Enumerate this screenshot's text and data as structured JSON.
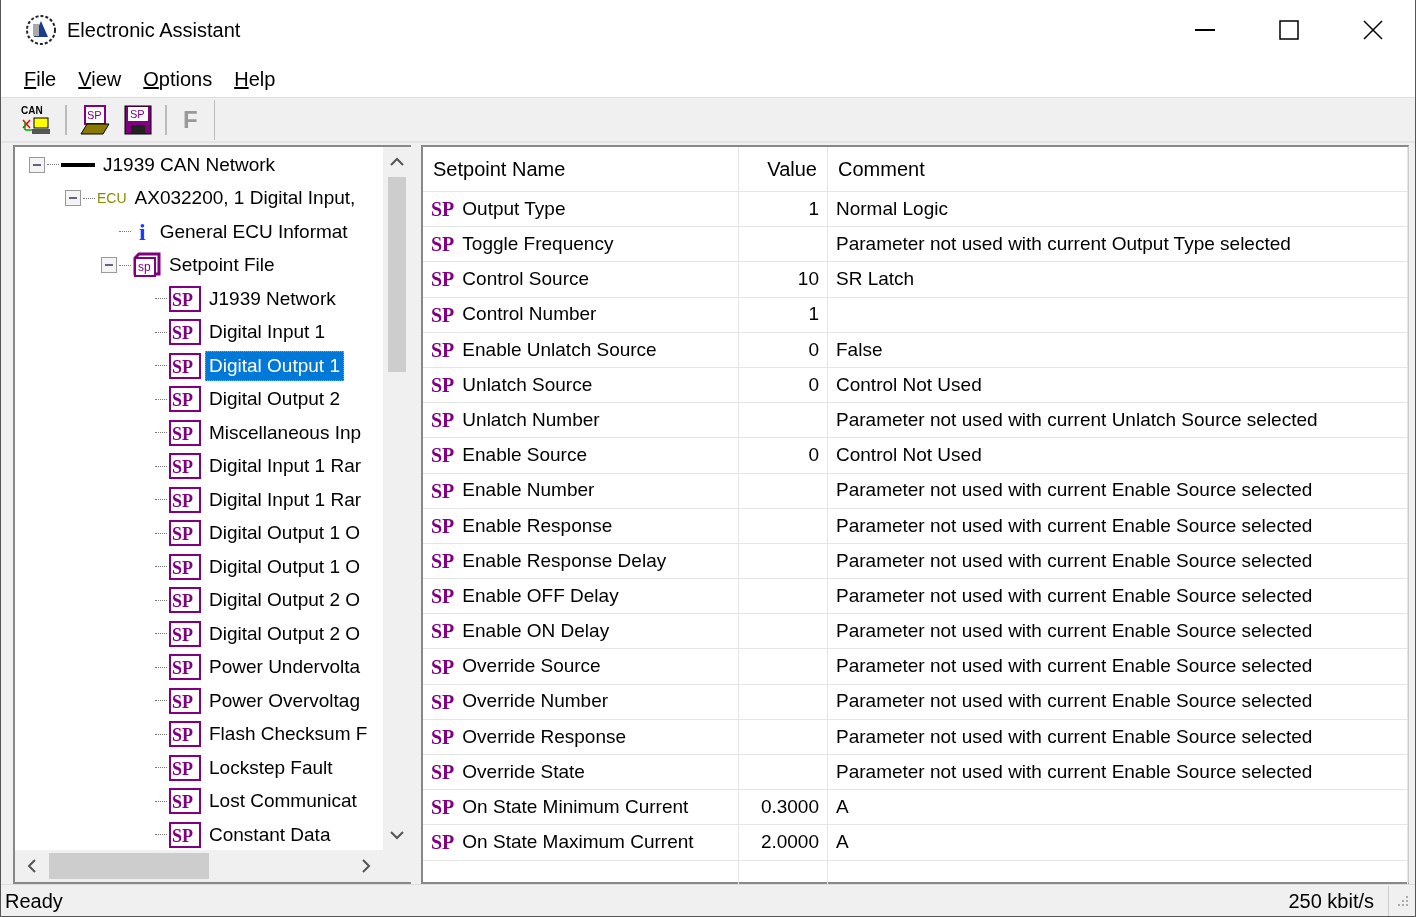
{
  "window": {
    "title": "Electronic Assistant"
  },
  "menu": [
    {
      "label": "File"
    },
    {
      "label": "View"
    },
    {
      "label": "Options"
    },
    {
      "label": "Help"
    }
  ],
  "toolbar": [
    {
      "kind": "can",
      "text": "CAN"
    },
    {
      "kind": "open",
      "text": "SP"
    },
    {
      "kind": "save",
      "text": "SP"
    },
    {
      "kind": "letter",
      "text": "F",
      "disabled": true
    }
  ],
  "tree": [
    {
      "kind": "network",
      "label": "J1939 CAN Network",
      "expanded": true,
      "selected": false,
      "children": [
        {
          "kind": "ecu",
          "icon_text": "ECU",
          "label": "AX032200, 1 Digital Input,",
          "expanded": true,
          "selected": false,
          "children": [
            {
              "kind": "info",
              "icon_text": "i",
              "label": "General ECU Informat",
              "selected": false
            },
            {
              "kind": "file",
              "icon_text": "sp",
              "label": "Setpoint File",
              "expanded": true,
              "selected": false,
              "children": [
                {
                  "kind": "setpoint",
                  "icon_text": "SP",
                  "label": "J1939 Network",
                  "selected": false
                },
                {
                  "kind": "setpoint",
                  "icon_text": "SP",
                  "label": "Digital Input 1",
                  "selected": false
                },
                {
                  "kind": "setpoint",
                  "icon_text": "SP",
                  "label": "Digital Output 1",
                  "selected": true
                },
                {
                  "kind": "setpoint",
                  "icon_text": "SP",
                  "label": "Digital Output 2",
                  "selected": false
                },
                {
                  "kind": "setpoint",
                  "icon_text": "SP",
                  "label": "Miscellaneous Inp",
                  "selected": false
                },
                {
                  "kind": "setpoint",
                  "icon_text": "SP",
                  "label": "Digital Input 1 Rar",
                  "selected": false
                },
                {
                  "kind": "setpoint",
                  "icon_text": "SP",
                  "label": "Digital Input 1 Rar",
                  "selected": false
                },
                {
                  "kind": "setpoint",
                  "icon_text": "SP",
                  "label": "Digital Output 1 O",
                  "selected": false
                },
                {
                  "kind": "setpoint",
                  "icon_text": "SP",
                  "label": "Digital Output 1 O",
                  "selected": false
                },
                {
                  "kind": "setpoint",
                  "icon_text": "SP",
                  "label": "Digital Output 2 O",
                  "selected": false
                },
                {
                  "kind": "setpoint",
                  "icon_text": "SP",
                  "label": "Digital Output 2 O",
                  "selected": false
                },
                {
                  "kind": "setpoint",
                  "icon_text": "SP",
                  "label": "Power Undervolta",
                  "selected": false
                },
                {
                  "kind": "setpoint",
                  "icon_text": "SP",
                  "label": "Power Overvoltag",
                  "selected": false
                },
                {
                  "kind": "setpoint",
                  "icon_text": "SP",
                  "label": "Flash Checksum F",
                  "selected": false
                },
                {
                  "kind": "setpoint",
                  "icon_text": "SP",
                  "label": "Lockstep Fault",
                  "selected": false
                },
                {
                  "kind": "setpoint",
                  "icon_text": "SP",
                  "label": "Lost Communicat",
                  "selected": false
                },
                {
                  "kind": "setpoint",
                  "icon_text": "SP",
                  "label": "Constant Data",
                  "selected": false
                }
              ]
            }
          ]
        }
      ]
    }
  ],
  "table": {
    "columns": [
      "Setpoint Name",
      "Value",
      "Comment"
    ],
    "rows": [
      {
        "tag": "SP",
        "name": "Output Type",
        "value": "1",
        "comment": "Normal Logic"
      },
      {
        "tag": "SP",
        "name": "Toggle Frequency",
        "comment": "Parameter not used with current Output Type selected"
      },
      {
        "tag": "SP",
        "name": "Control Source",
        "value": "10",
        "comment": "SR Latch"
      },
      {
        "tag": "SP",
        "name": "Control Number",
        "value": "1"
      },
      {
        "tag": "SP",
        "name": "Enable Unlatch Source",
        "value": "0",
        "comment": "False"
      },
      {
        "tag": "SP",
        "name": "Unlatch Source",
        "value": "0",
        "comment": "Control Not Used"
      },
      {
        "tag": "SP",
        "name": "Unlatch Number",
        "comment": "Parameter not used with current Unlatch Source selected"
      },
      {
        "tag": "SP",
        "name": "Enable Source",
        "value": "0",
        "comment": "Control Not Used"
      },
      {
        "tag": "SP",
        "name": "Enable Number",
        "comment": "Parameter not used with current Enable Source selected"
      },
      {
        "tag": "SP",
        "name": "Enable Response",
        "comment": "Parameter not used with current Enable Source selected"
      },
      {
        "tag": "SP",
        "name": "Enable Response Delay",
        "comment": "Parameter not used with current Enable Source selected"
      },
      {
        "tag": "SP",
        "name": "Enable OFF Delay",
        "comment": "Parameter not used with current Enable Source selected"
      },
      {
        "tag": "SP",
        "name": "Enable ON Delay",
        "comment": "Parameter not used with current Enable Source selected"
      },
      {
        "tag": "SP",
        "name": "Override Source",
        "comment": "Parameter not used with current Enable Source selected"
      },
      {
        "tag": "SP",
        "name": "Override Number",
        "comment": "Parameter not used with current Enable Source selected"
      },
      {
        "tag": "SP",
        "name": "Override Response",
        "comment": "Parameter not used with current Enable Source selected"
      },
      {
        "tag": "SP",
        "name": "Override State",
        "comment": "Parameter not used with current Enable Source selected"
      },
      {
        "tag": "SP",
        "name": "On State Minimum Current",
        "value": "0.3000",
        "comment": "A"
      },
      {
        "tag": "SP",
        "name": "On State Maximum Current",
        "value": "2.0000",
        "comment": "A"
      }
    ]
  },
  "status_bar": {
    "message": "Ready",
    "baud_rate": "250 kbit/s"
  }
}
